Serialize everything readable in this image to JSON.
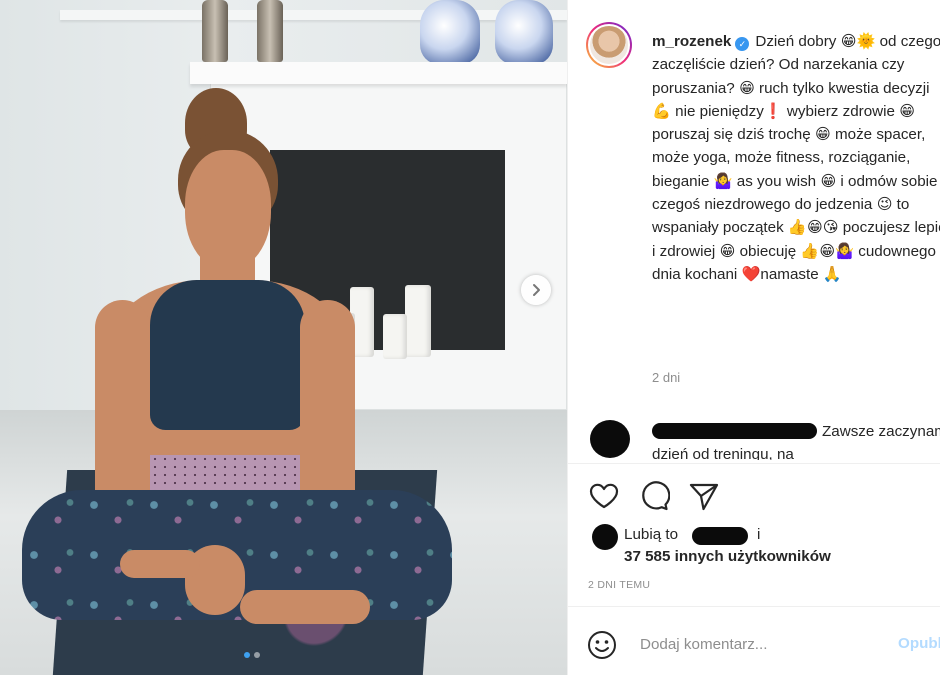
{
  "post": {
    "username": "m_rozenek",
    "verified_icon": "verified-badge-icon",
    "caption": "Dzień dobry 😁🌞 od czego zaczęliście dzień? Od narzekania czy poruszania? 😁 ruch tylko kwestia decyzji 💪 nie pieniędzy❗ wybierz zdrowie 😁 poruszaj się dziś trochę 😁 może spacer, może yoga, może fitness, rozciąganie, bieganie 🤷‍♀️ as you wish 😁 i odmów sobie czegoś niezdrowego do jedzenia 😉 to wspaniały początek 👍😁😘 poczujesz lepiej i zdrowiej 😁 obiecuję 👍😁🤷‍♀️ cudownego dnia kochani ❤️namaste 🙏",
    "time_ago": "2 dni"
  },
  "comment": {
    "text": "Zawsze zaczynam dzień od treningu, na"
  },
  "likes": {
    "prefix": "Lubią to",
    "suffix": "i",
    "count_text": "37 585 innych użytkowników"
  },
  "date": "2 DNI TEMU",
  "add_comment": {
    "placeholder": "Dodaj komentarz...",
    "publish_label": "Opublikuj"
  },
  "carousel": {
    "slide_count": 2,
    "active_index": 0
  },
  "colors": {
    "accent": "#3897f0",
    "publish_disabled": "#b3dbff",
    "text": "#262626",
    "muted": "#8e8e8e"
  }
}
